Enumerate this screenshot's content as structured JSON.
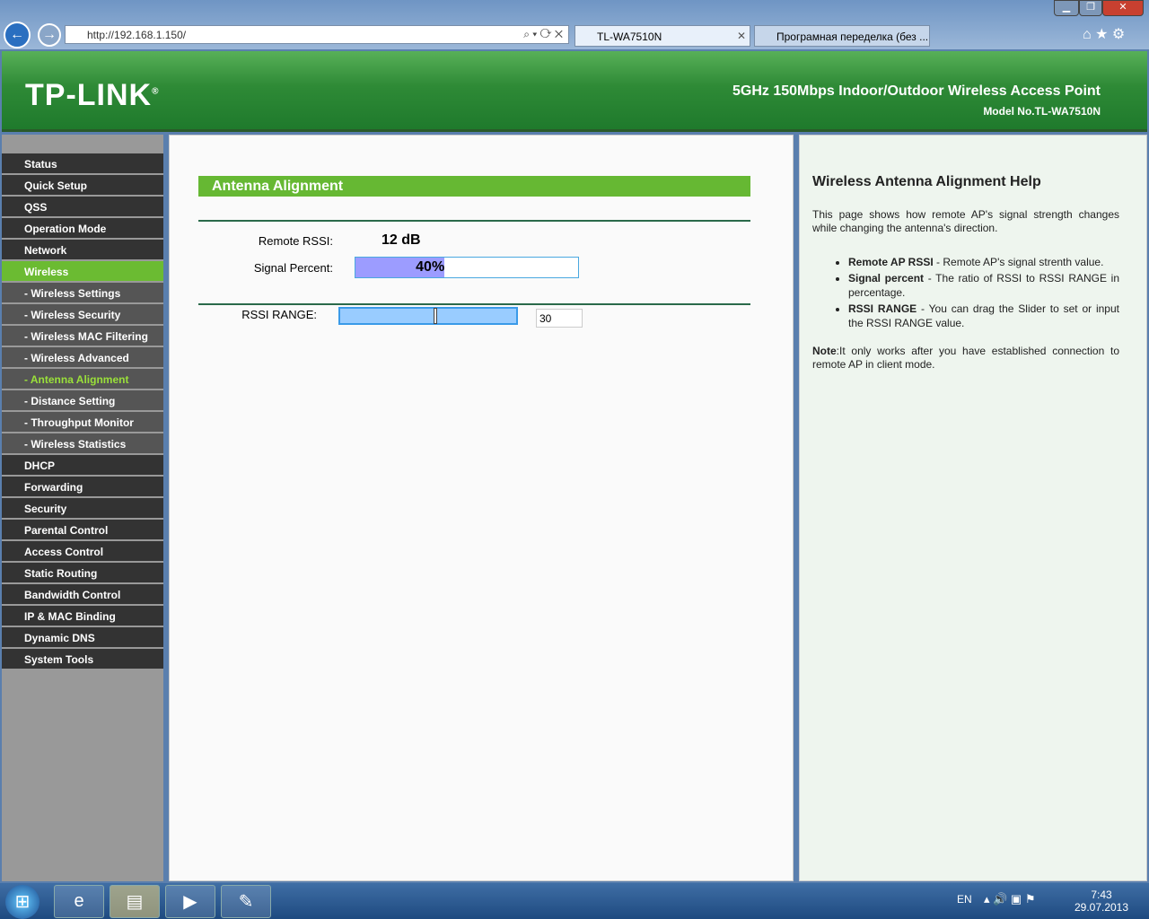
{
  "browser": {
    "url": "http://192.168.1.150/",
    "tabs": [
      {
        "label": "TL-WA7510N"
      },
      {
        "label": "Програмная переделка (без ..."
      }
    ]
  },
  "header": {
    "logo": "TP-LINK",
    "logo_mark": "®",
    "product": "5GHz 150Mbps Indoor/Outdoor Wireless Access Point",
    "model": "Model No.TL-WA7510N"
  },
  "sidebar": {
    "items": [
      {
        "label": "Status"
      },
      {
        "label": "Quick Setup"
      },
      {
        "label": "QSS"
      },
      {
        "label": "Operation Mode"
      },
      {
        "label": "Network"
      },
      {
        "label": "Wireless"
      },
      {
        "label": "- Wireless Settings"
      },
      {
        "label": "- Wireless Security"
      },
      {
        "label": "- Wireless MAC Filtering"
      },
      {
        "label": "- Wireless Advanced"
      },
      {
        "label": "- Antenna Alignment"
      },
      {
        "label": "- Distance Setting"
      },
      {
        "label": "- Throughput Monitor"
      },
      {
        "label": "- Wireless Statistics"
      },
      {
        "label": "DHCP"
      },
      {
        "label": "Forwarding"
      },
      {
        "label": "Security"
      },
      {
        "label": "Parental Control"
      },
      {
        "label": "Access Control"
      },
      {
        "label": "Static Routing"
      },
      {
        "label": "Bandwidth Control"
      },
      {
        "label": "IP & MAC Binding"
      },
      {
        "label": "Dynamic DNS"
      },
      {
        "label": "System Tools"
      }
    ]
  },
  "main": {
    "title": "Antenna Alignment",
    "rssi_label": "Remote RSSI:",
    "rssi_value": "12 dB",
    "signal_label": "Signal Percent:",
    "signal_text": "40%",
    "signal_percent": 40,
    "range_label": "RSSI RANGE:",
    "range_value": "30",
    "slider_fraction": 0.54
  },
  "help": {
    "title": "Wireless Antenna Alignment Help",
    "intro": "This page shows how remote AP's signal strength changes while changing the antenna's direction.",
    "items": [
      {
        "term": "Remote AP RSSI",
        "desc": " - Remote AP's signal strenth value."
      },
      {
        "term": "Signal percent",
        "desc": " - The ratio of RSSI to RSSI RANGE in percentage."
      },
      {
        "term": "RSSI RANGE",
        "desc": " - You can drag the Slider to set or input the RSSI RANGE value."
      }
    ],
    "note_term": "Note",
    "note": ":It only works after you have established connection to remote AP in client mode."
  },
  "taskbar": {
    "lang": "EN",
    "time": "7:43",
    "date": "29.07.2013"
  }
}
